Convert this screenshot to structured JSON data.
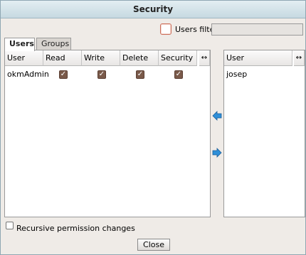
{
  "dialog": {
    "title": "Security"
  },
  "filter": {
    "label": "Users filter",
    "value": "",
    "checked": false
  },
  "tabs": [
    {
      "label": "Users",
      "active": true
    },
    {
      "label": "Groups",
      "active": false
    }
  ],
  "granted": {
    "columns": [
      "User",
      "Read",
      "Write",
      "Delete",
      "Security"
    ],
    "resize_glyph": "↔",
    "rows": [
      {
        "user": "okmAdmin",
        "read": true,
        "write": true,
        "delete": true,
        "security": true
      }
    ]
  },
  "available": {
    "columns": [
      "User"
    ],
    "resize_glyph": "↔",
    "rows": [
      {
        "user": "josep"
      }
    ]
  },
  "icons": {
    "remove": "arrow-left-icon",
    "add": "arrow-right-icon"
  },
  "colors": {
    "arrow": "#2f8fd8",
    "checkbox": "#7a5a4a",
    "title_bar": "#c6d9e1"
  },
  "recursive": {
    "label": "Recursive permission changes",
    "checked": false
  },
  "close_label": "Close"
}
